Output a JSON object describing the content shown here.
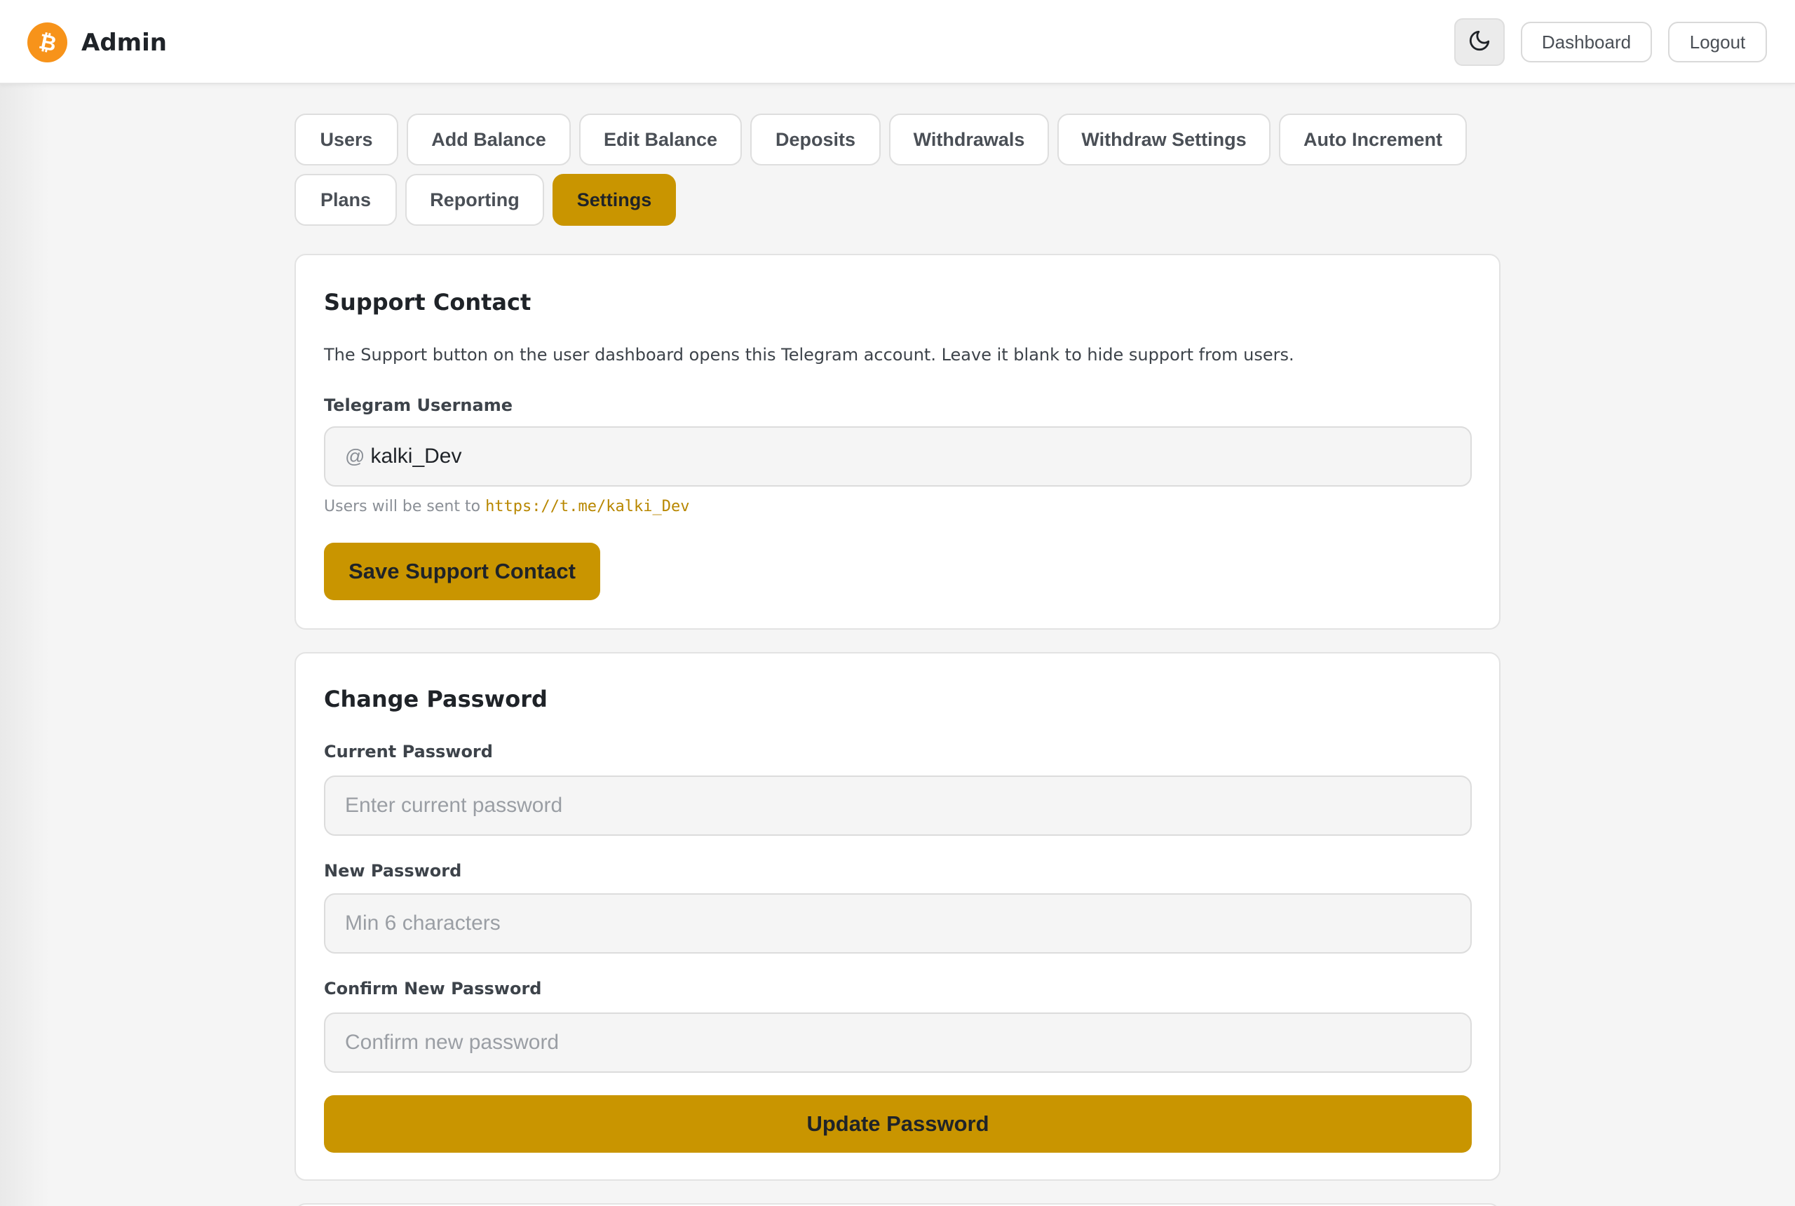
{
  "header": {
    "title": "Admin",
    "logo_icon": "bitcoin-icon",
    "theme_toggle_icon": "moon-icon",
    "dashboard_label": "Dashboard",
    "logout_label": "Logout"
  },
  "tabs": [
    {
      "label": "Users",
      "active": false
    },
    {
      "label": "Add Balance",
      "active": false
    },
    {
      "label": "Edit Balance",
      "active": false
    },
    {
      "label": "Deposits",
      "active": false
    },
    {
      "label": "Withdrawals",
      "active": false
    },
    {
      "label": "Withdraw Settings",
      "active": false
    },
    {
      "label": "Auto Increment",
      "active": false
    },
    {
      "label": "Plans",
      "active": false
    },
    {
      "label": "Reporting",
      "active": false
    },
    {
      "label": "Settings",
      "active": true
    }
  ],
  "support": {
    "title": "Support Contact",
    "description": "The Support button on the user dashboard opens this Telegram account. Leave it blank to hide support from users.",
    "username_label": "Telegram Username",
    "username_prefix": "@",
    "username_value": "kalki_Dev",
    "hint_text": "Users will be sent to",
    "hint_link": "https://t.me/kalki_Dev",
    "save_label": "Save Support Contact"
  },
  "password": {
    "title": "Change Password",
    "current_label": "Current Password",
    "current_placeholder": "Enter current password",
    "new_label": "New Password",
    "new_placeholder": "Min 6 characters",
    "confirm_label": "Confirm New Password",
    "confirm_placeholder": "Confirm new password",
    "update_label": "Update Password"
  },
  "colors": {
    "accent": "#c99500",
    "brand_orange": "#f7931a",
    "link": "#b88700"
  }
}
